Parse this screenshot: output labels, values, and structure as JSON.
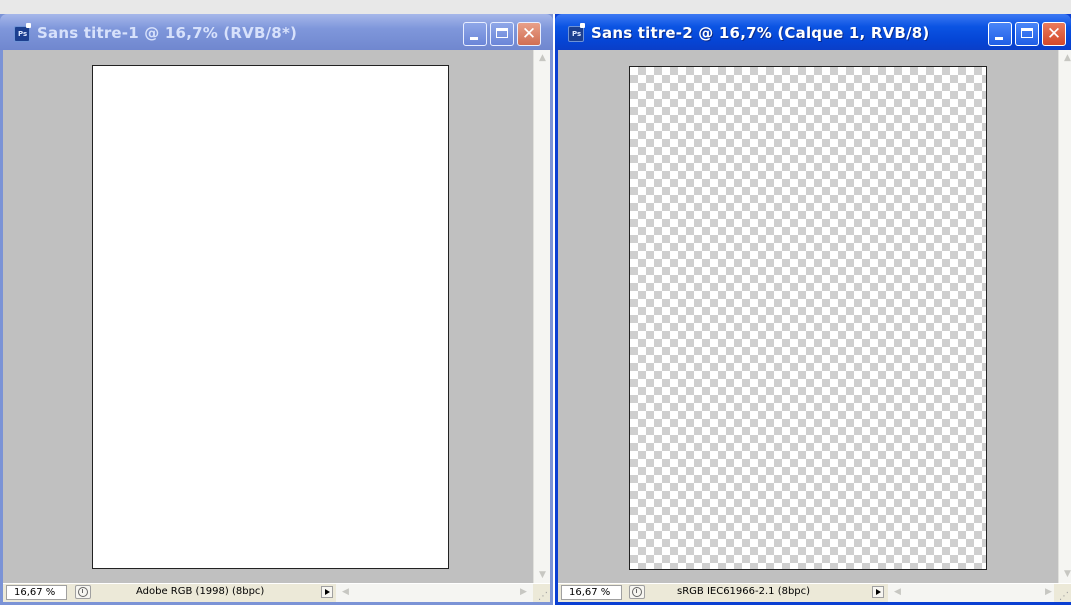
{
  "windows": [
    {
      "title": "Sans titre-1 @ 16,7% (RVB/8*)",
      "state": "inactive",
      "app_icon": "photoshop-icon",
      "icon_label": "Ps",
      "zoom": "16,67 %",
      "profile": "Adobe RGB (1998) (8bpc)",
      "canvas": "white"
    },
    {
      "title": "Sans titre-2 @ 16,7% (Calque 1, RVB/8)",
      "state": "active",
      "app_icon": "photoshop-icon",
      "icon_label": "Ps",
      "zoom": "16,67 %",
      "profile": "sRGB IEC61966-2.1 (8bpc)",
      "canvas": "transparent-checkerboard"
    }
  ],
  "controls": {
    "close_glyph": "✕",
    "up_arrow": "▲",
    "down_arrow": "▼",
    "left_arrow": "◀",
    "right_arrow": "▶"
  },
  "colors": {
    "active_title": "#0546d7",
    "inactive_title": "#7f97db",
    "workspace": "#c0c0c0",
    "status_bar": "#ece9d8"
  }
}
